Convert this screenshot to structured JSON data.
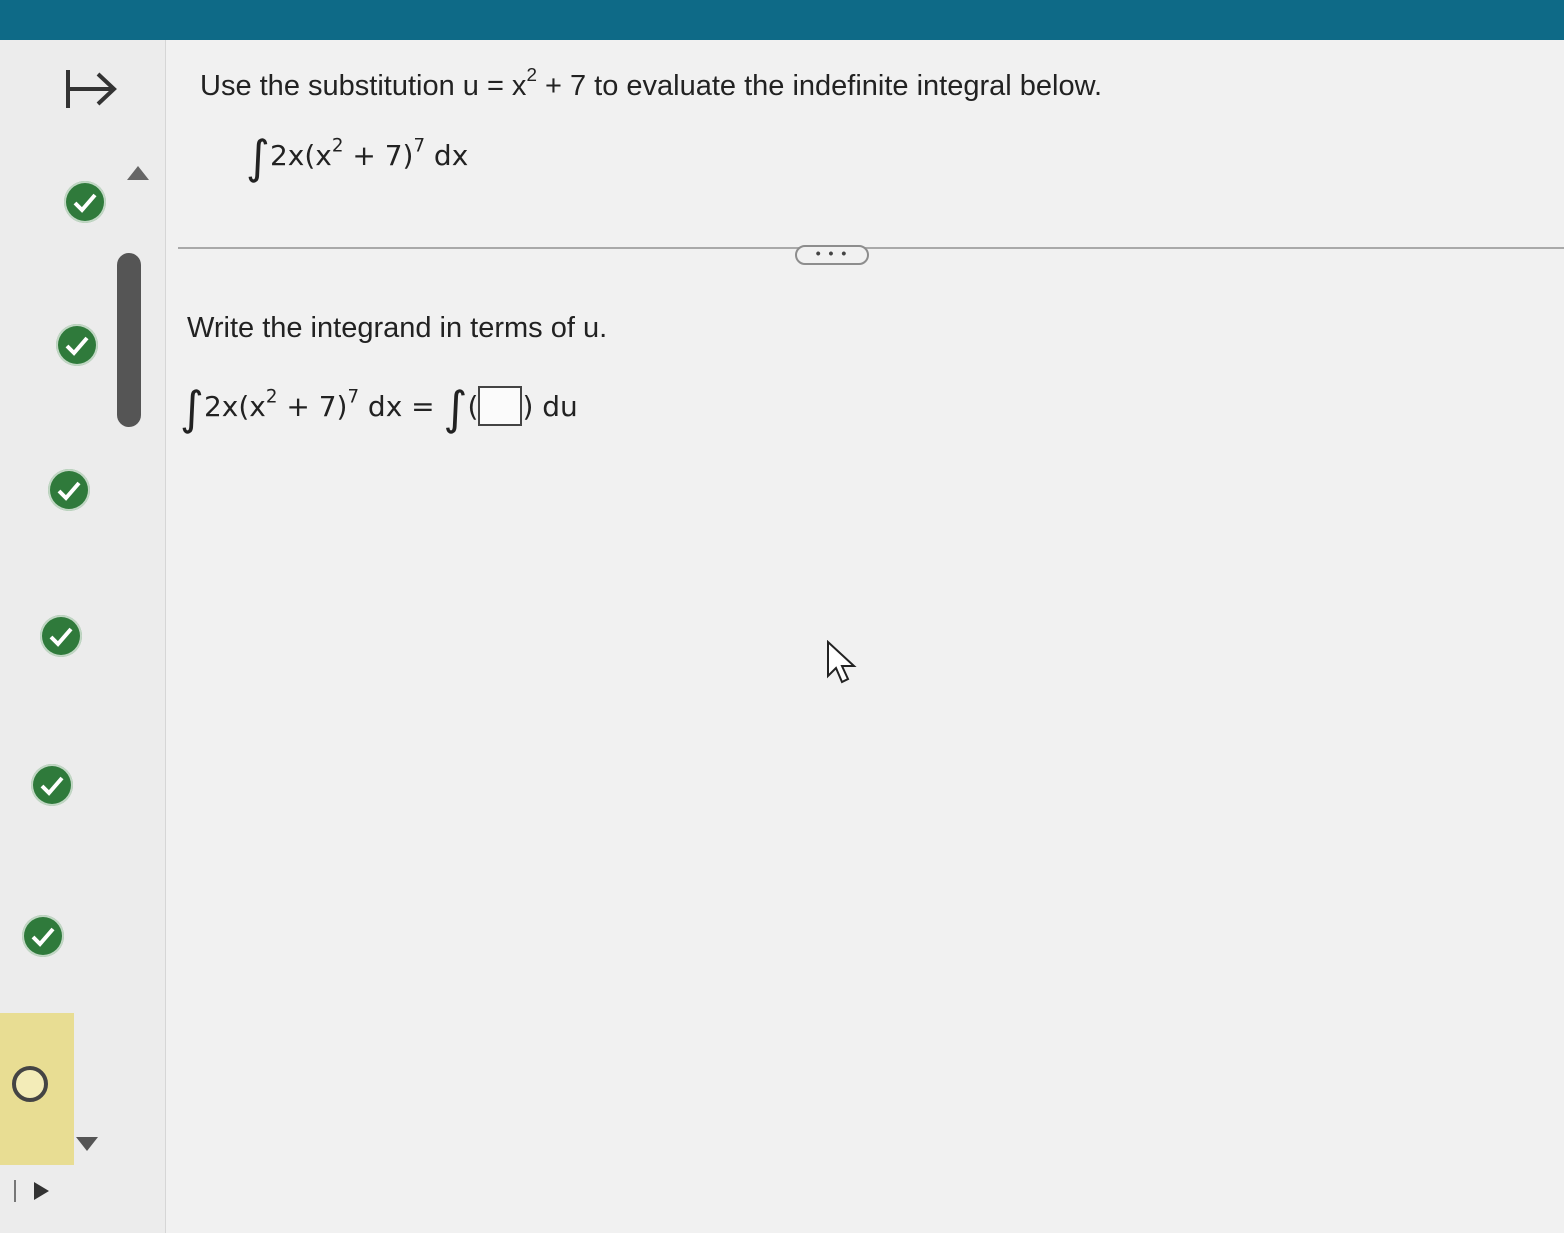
{
  "question": {
    "prompt_before": "Use the substitution u = x",
    "prompt_sup": "2",
    "prompt_after": " + 7 to evaluate the indefinite integral below.",
    "integral": {
      "sign": "∫",
      "coef": "2x",
      "open": "(x",
      "inner_exp": "2",
      "inner_rest": " + 7)",
      "outer_exp": "7",
      "dx": " dx"
    }
  },
  "step": {
    "instruction": "Write the integrand in terms of u.",
    "lhs": {
      "sign": "∫",
      "coef": "2x",
      "open": "(x",
      "inner_exp": "2",
      "inner_rest": " + 7)",
      "outer_exp": "7",
      "dx": " dx = "
    },
    "rhs": {
      "sign": "∫",
      "paren_open": "(",
      "paren_close": ")",
      "du": " du"
    },
    "answer_value": ""
  },
  "toolbar": {
    "more_label": "• • •"
  },
  "progress": {
    "items": [
      "complete",
      "complete",
      "complete",
      "complete",
      "complete",
      "complete",
      "current"
    ]
  },
  "colors": {
    "topbar": "#0e6a87",
    "check": "#2f7a3b",
    "current_highlight": "#e8dd93"
  },
  "icons": {
    "collapse": "collapse-arrow-icon",
    "complete": "check-circle-icon",
    "current": "open-circle-icon",
    "cursor": "mouse-pointer-icon"
  }
}
